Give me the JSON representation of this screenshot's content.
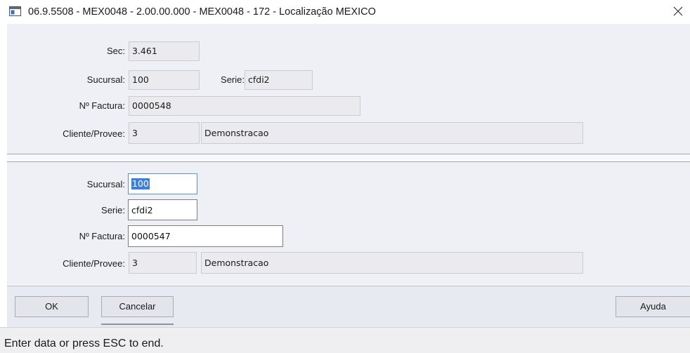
{
  "window": {
    "title": "06.9.5508 - MEX0048 - 2.00.00.000 - MEX0048 - 172 - Localização MEXICO",
    "close_glyph": "✕",
    "icon": "app-window-icon"
  },
  "record_section": {
    "sec": {
      "label": "Sec:",
      "value": "3.461"
    },
    "sucursal": {
      "label": "Sucursal:",
      "value": "100"
    },
    "serie": {
      "label": "Serie:",
      "value": "cfdi2"
    },
    "factura": {
      "label": "Nº Factura:",
      "value": "0000548"
    },
    "cliente": {
      "label": "Cliente/Provee:",
      "code": "3",
      "name": "Demonstracao"
    }
  },
  "edit_section": {
    "sucursal": {
      "label": "Sucursal:",
      "value": "100"
    },
    "serie": {
      "label": "Serie:",
      "value": "cfdi2"
    },
    "factura": {
      "label": "Nº Factura:",
      "value": "0000547"
    },
    "cliente": {
      "label": "Cliente/Provee:",
      "code": "3",
      "name": "Demonstracao"
    }
  },
  "buttons": {
    "ok": "OK",
    "cancel": "Cancelar",
    "help": "Ayuda"
  },
  "status": {
    "text": "Enter data or press ESC to end."
  },
  "colors": {
    "panel_bg": "#eff0f5",
    "field_readonly_bg": "#ebebef",
    "selection": "#3d7fd9",
    "button_bar_bg": "#e8eaf2"
  }
}
